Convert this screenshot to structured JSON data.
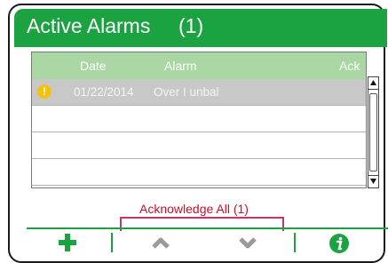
{
  "window": {
    "title": "Active Alarms",
    "count": "(1)"
  },
  "table": {
    "columns": [
      "Date",
      "Alarm",
      "Ack"
    ],
    "rows": [
      {
        "icon": "warning-icon",
        "date": "01/22/2014",
        "alarm": "Over I unbal",
        "ack": ""
      },
      {
        "icon": "",
        "date": "",
        "alarm": "",
        "ack": ""
      },
      {
        "icon": "",
        "date": "",
        "alarm": "",
        "ack": ""
      },
      {
        "icon": "",
        "date": "",
        "alarm": "",
        "ack": ""
      }
    ]
  },
  "actions": {
    "acknowledge_all": "Acknowledge All (1)"
  },
  "toolbar": {
    "items": [
      "plus-icon",
      "chevron-up-icon",
      "chevron-down-icon",
      "info-icon"
    ]
  },
  "colors": {
    "accent": "#1ba241",
    "header_bg": "#a9d6a3",
    "selected_row": "#c8c8c8",
    "ack_text": "#c4102c",
    "warning": "#f4c20d"
  }
}
